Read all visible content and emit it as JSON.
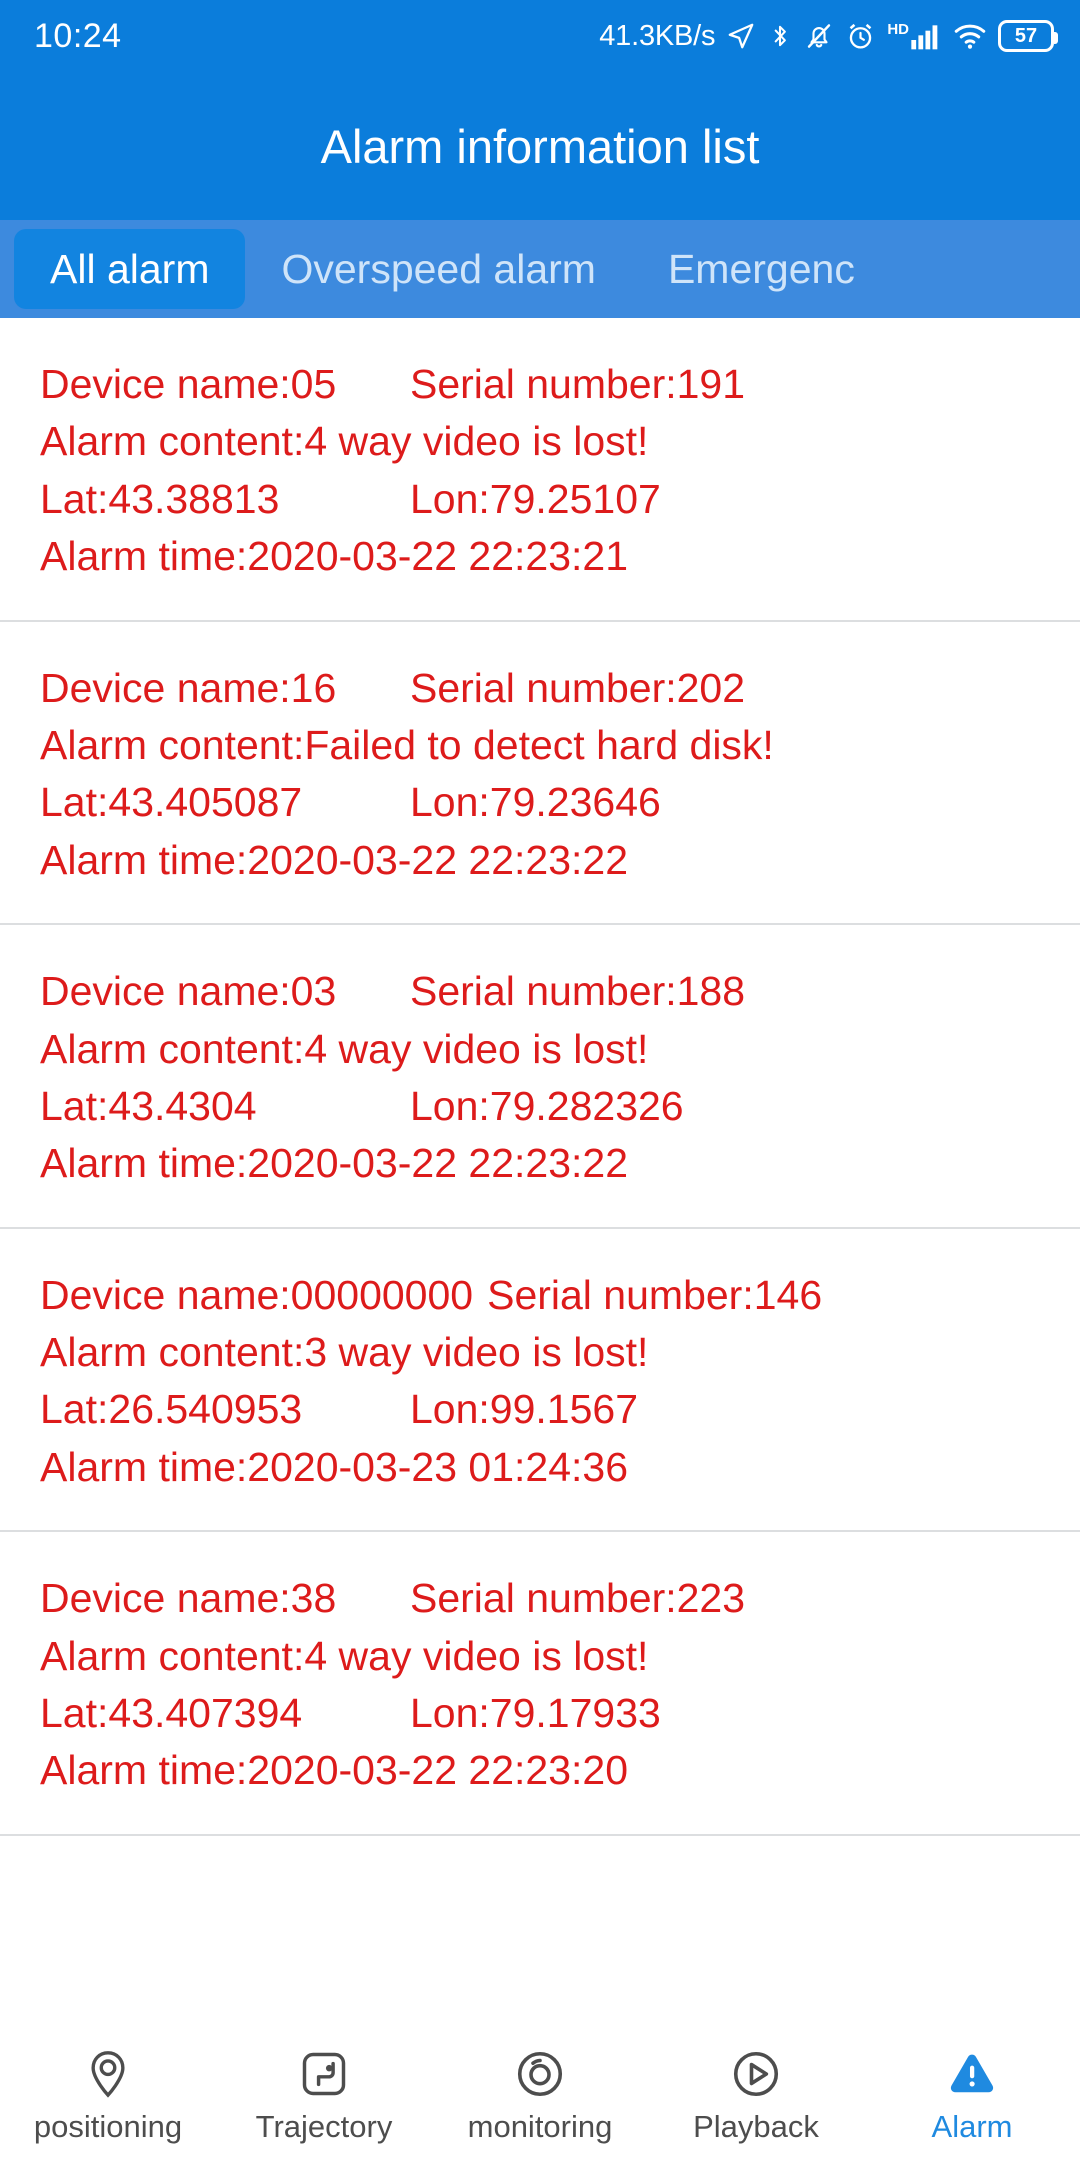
{
  "status_bar": {
    "time": "10:24",
    "network_speed": "41.3KB/s",
    "hd_tag": "HD",
    "battery_level": "57",
    "icons": [
      "location-arrow-icon",
      "bluetooth-icon",
      "mute-bell-icon",
      "alarm-clock-icon",
      "signal-bars-icon",
      "wifi-icon",
      "battery-icon"
    ]
  },
  "header": {
    "title": "Alarm information list",
    "bg_color": "#0b7ddb"
  },
  "tabs": {
    "bg_color": "#3d8ade",
    "active_color": "#1284e0",
    "items": [
      {
        "label": "All alarm",
        "active": true
      },
      {
        "label": "Overspeed alarm",
        "active": false
      },
      {
        "label": "Emergenc",
        "active": false
      }
    ]
  },
  "list": {
    "text_color": "#dd1b1b",
    "labels": {
      "device_name": "Device name:",
      "serial_number": "Serial number:",
      "alarm_content": "Alarm content:",
      "lat": "Lat:",
      "lon": "Lon:",
      "alarm_time": "Alarm time:"
    },
    "items": [
      {
        "device_name": "Device name:05",
        "serial_number": "Serial number:191",
        "alarm_content": "Alarm content:4 way video is lost!",
        "lat": "Lat:43.38813",
        "lon": "Lon:79.25107",
        "alarm_time": "Alarm time:2020-03-22 22:23:21"
      },
      {
        "device_name": "Device name:16",
        "serial_number": "Serial number:202",
        "alarm_content": "Alarm content:Failed to detect hard disk!",
        "lat": "Lat:43.405087",
        "lon": "Lon:79.23646",
        "alarm_time": "Alarm time:2020-03-22 22:23:22"
      },
      {
        "device_name": "Device name:03",
        "serial_number": "Serial number:188",
        "alarm_content": "Alarm content:4 way video is lost!",
        "lat": "Lat:43.4304",
        "lon": "Lon:79.282326",
        "alarm_time": "Alarm time:2020-03-22 22:23:22"
      },
      {
        "device_name": "Device name:00000000",
        "serial_number": "Serial number:146",
        "alarm_content": "Alarm content:3 way video is lost!",
        "lat": "Lat:26.540953",
        "lon": "Lon:99.1567",
        "alarm_time": "Alarm time:2020-03-23 01:24:36"
      },
      {
        "device_name": "Device name:38",
        "serial_number": "Serial number:223",
        "alarm_content": "Alarm content:4 way video is lost!",
        "lat": "Lat:43.407394",
        "lon": "Lon:79.17933",
        "alarm_time": "Alarm time:2020-03-22 22:23:20"
      }
    ]
  },
  "bottom_nav": {
    "active_color": "#1f8ae0",
    "inactive_color": "#4d4d4d",
    "items": [
      {
        "label": "positioning",
        "icon": "map-pin-icon",
        "active": false
      },
      {
        "label": "Trajectory",
        "icon": "trajectory-icon",
        "active": false
      },
      {
        "label": "monitoring",
        "icon": "camera-lens-icon",
        "active": false
      },
      {
        "label": "Playback",
        "icon": "play-circle-icon",
        "active": false
      },
      {
        "label": "Alarm",
        "icon": "warning-triangle-icon",
        "active": true
      }
    ]
  }
}
